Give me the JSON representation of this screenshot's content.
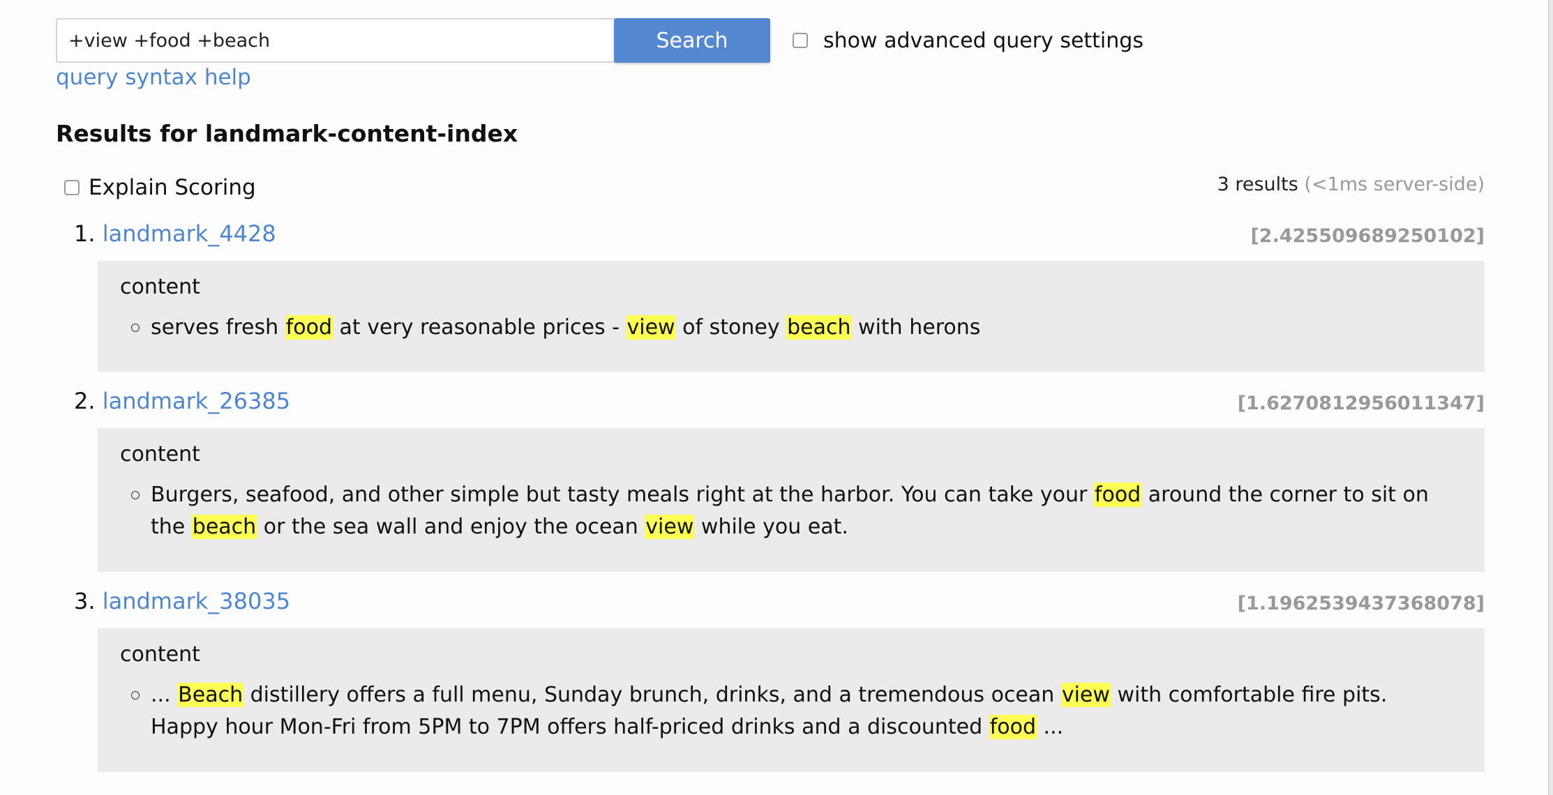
{
  "search": {
    "query_value": "+view +food +beach",
    "button_label": "Search",
    "advanced_label": "show advanced query settings",
    "advanced_checked": false,
    "syntax_help_label": "query syntax help"
  },
  "results_header": {
    "title": "Results for landmark-content-index",
    "explain_label": "Explain Scoring",
    "explain_checked": false,
    "count_text": "3 results",
    "timing_text": "(<1ms server-side)"
  },
  "results": [
    {
      "rank": "1.",
      "doc_id": "landmark_4428",
      "score": "[2.425509689250102]",
      "field": "content",
      "fragments": [
        {
          "t": "serves fresh ",
          "h": false
        },
        {
          "t": "food",
          "h": true
        },
        {
          "t": " at very reasonable prices - ",
          "h": false
        },
        {
          "t": "view",
          "h": true
        },
        {
          "t": " of stoney ",
          "h": false
        },
        {
          "t": "beach",
          "h": true
        },
        {
          "t": " with herons",
          "h": false
        }
      ]
    },
    {
      "rank": "2.",
      "doc_id": "landmark_26385",
      "score": "[1.6270812956011347]",
      "field": "content",
      "fragments": [
        {
          "t": "Burgers, seafood, and other simple but tasty meals right at the harbor. You can take your ",
          "h": false
        },
        {
          "t": "food",
          "h": true
        },
        {
          "t": " around the corner to sit on the ",
          "h": false
        },
        {
          "t": "beach",
          "h": true
        },
        {
          "t": " or the sea wall and enjoy the ocean ",
          "h": false
        },
        {
          "t": "view",
          "h": true
        },
        {
          "t": " while you eat.",
          "h": false
        }
      ]
    },
    {
      "rank": "3.",
      "doc_id": "landmark_38035",
      "score": "[1.1962539437368078]",
      "field": "content",
      "fragments": [
        {
          "t": "... ",
          "h": false
        },
        {
          "t": "Beach",
          "h": true
        },
        {
          "t": " distillery offers a full menu, Sunday brunch, drinks, and a tremendous ocean ",
          "h": false
        },
        {
          "t": "view",
          "h": true
        },
        {
          "t": " with comfortable fire pits. Happy hour Mon-Fri from 5PM to 7PM offers half-priced drinks and a discounted ",
          "h": false
        },
        {
          "t": "food",
          "h": true
        },
        {
          "t": " ...",
          "h": false
        }
      ]
    }
  ],
  "colors": {
    "link": "#4f86cd",
    "button": "#5588d0",
    "highlight": "#ffff55",
    "box_bg": "#ebebeb",
    "muted": "#999999"
  }
}
